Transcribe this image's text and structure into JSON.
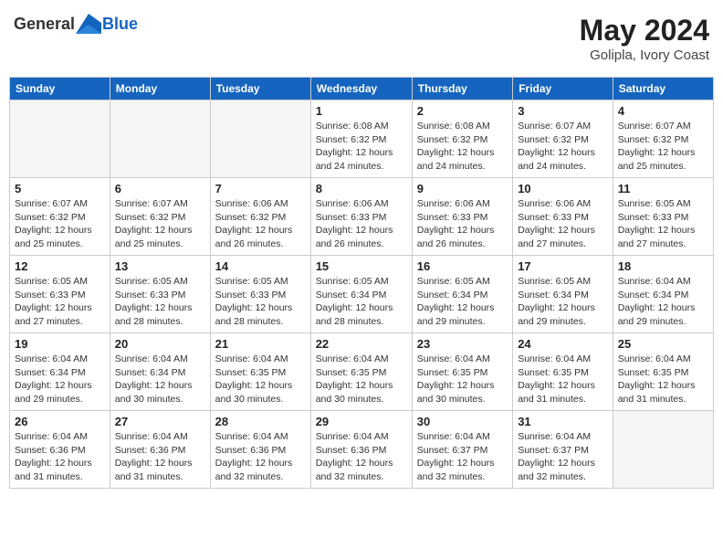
{
  "header": {
    "logo_general": "General",
    "logo_blue": "Blue",
    "title": "May 2024",
    "location": "Golipla, Ivory Coast"
  },
  "weekdays": [
    "Sunday",
    "Monday",
    "Tuesday",
    "Wednesday",
    "Thursday",
    "Friday",
    "Saturday"
  ],
  "weeks": [
    [
      {
        "day": "",
        "info": ""
      },
      {
        "day": "",
        "info": ""
      },
      {
        "day": "",
        "info": ""
      },
      {
        "day": "1",
        "info": "Sunrise: 6:08 AM\nSunset: 6:32 PM\nDaylight: 12 hours\nand 24 minutes."
      },
      {
        "day": "2",
        "info": "Sunrise: 6:08 AM\nSunset: 6:32 PM\nDaylight: 12 hours\nand 24 minutes."
      },
      {
        "day": "3",
        "info": "Sunrise: 6:07 AM\nSunset: 6:32 PM\nDaylight: 12 hours\nand 24 minutes."
      },
      {
        "day": "4",
        "info": "Sunrise: 6:07 AM\nSunset: 6:32 PM\nDaylight: 12 hours\nand 25 minutes."
      }
    ],
    [
      {
        "day": "5",
        "info": "Sunrise: 6:07 AM\nSunset: 6:32 PM\nDaylight: 12 hours\nand 25 minutes."
      },
      {
        "day": "6",
        "info": "Sunrise: 6:07 AM\nSunset: 6:32 PM\nDaylight: 12 hours\nand 25 minutes."
      },
      {
        "day": "7",
        "info": "Sunrise: 6:06 AM\nSunset: 6:32 PM\nDaylight: 12 hours\nand 26 minutes."
      },
      {
        "day": "8",
        "info": "Sunrise: 6:06 AM\nSunset: 6:33 PM\nDaylight: 12 hours\nand 26 minutes."
      },
      {
        "day": "9",
        "info": "Sunrise: 6:06 AM\nSunset: 6:33 PM\nDaylight: 12 hours\nand 26 minutes."
      },
      {
        "day": "10",
        "info": "Sunrise: 6:06 AM\nSunset: 6:33 PM\nDaylight: 12 hours\nand 27 minutes."
      },
      {
        "day": "11",
        "info": "Sunrise: 6:05 AM\nSunset: 6:33 PM\nDaylight: 12 hours\nand 27 minutes."
      }
    ],
    [
      {
        "day": "12",
        "info": "Sunrise: 6:05 AM\nSunset: 6:33 PM\nDaylight: 12 hours\nand 27 minutes."
      },
      {
        "day": "13",
        "info": "Sunrise: 6:05 AM\nSunset: 6:33 PM\nDaylight: 12 hours\nand 28 minutes."
      },
      {
        "day": "14",
        "info": "Sunrise: 6:05 AM\nSunset: 6:33 PM\nDaylight: 12 hours\nand 28 minutes."
      },
      {
        "day": "15",
        "info": "Sunrise: 6:05 AM\nSunset: 6:34 PM\nDaylight: 12 hours\nand 28 minutes."
      },
      {
        "day": "16",
        "info": "Sunrise: 6:05 AM\nSunset: 6:34 PM\nDaylight: 12 hours\nand 29 minutes."
      },
      {
        "day": "17",
        "info": "Sunrise: 6:05 AM\nSunset: 6:34 PM\nDaylight: 12 hours\nand 29 minutes."
      },
      {
        "day": "18",
        "info": "Sunrise: 6:04 AM\nSunset: 6:34 PM\nDaylight: 12 hours\nand 29 minutes."
      }
    ],
    [
      {
        "day": "19",
        "info": "Sunrise: 6:04 AM\nSunset: 6:34 PM\nDaylight: 12 hours\nand 29 minutes."
      },
      {
        "day": "20",
        "info": "Sunrise: 6:04 AM\nSunset: 6:34 PM\nDaylight: 12 hours\nand 30 minutes."
      },
      {
        "day": "21",
        "info": "Sunrise: 6:04 AM\nSunset: 6:35 PM\nDaylight: 12 hours\nand 30 minutes."
      },
      {
        "day": "22",
        "info": "Sunrise: 6:04 AM\nSunset: 6:35 PM\nDaylight: 12 hours\nand 30 minutes."
      },
      {
        "day": "23",
        "info": "Sunrise: 6:04 AM\nSunset: 6:35 PM\nDaylight: 12 hours\nand 30 minutes."
      },
      {
        "day": "24",
        "info": "Sunrise: 6:04 AM\nSunset: 6:35 PM\nDaylight: 12 hours\nand 31 minutes."
      },
      {
        "day": "25",
        "info": "Sunrise: 6:04 AM\nSunset: 6:35 PM\nDaylight: 12 hours\nand 31 minutes."
      }
    ],
    [
      {
        "day": "26",
        "info": "Sunrise: 6:04 AM\nSunset: 6:36 PM\nDaylight: 12 hours\nand 31 minutes."
      },
      {
        "day": "27",
        "info": "Sunrise: 6:04 AM\nSunset: 6:36 PM\nDaylight: 12 hours\nand 31 minutes."
      },
      {
        "day": "28",
        "info": "Sunrise: 6:04 AM\nSunset: 6:36 PM\nDaylight: 12 hours\nand 32 minutes."
      },
      {
        "day": "29",
        "info": "Sunrise: 6:04 AM\nSunset: 6:36 PM\nDaylight: 12 hours\nand 32 minutes."
      },
      {
        "day": "30",
        "info": "Sunrise: 6:04 AM\nSunset: 6:37 PM\nDaylight: 12 hours\nand 32 minutes."
      },
      {
        "day": "31",
        "info": "Sunrise: 6:04 AM\nSunset: 6:37 PM\nDaylight: 12 hours\nand 32 minutes."
      },
      {
        "day": "",
        "info": ""
      }
    ]
  ]
}
